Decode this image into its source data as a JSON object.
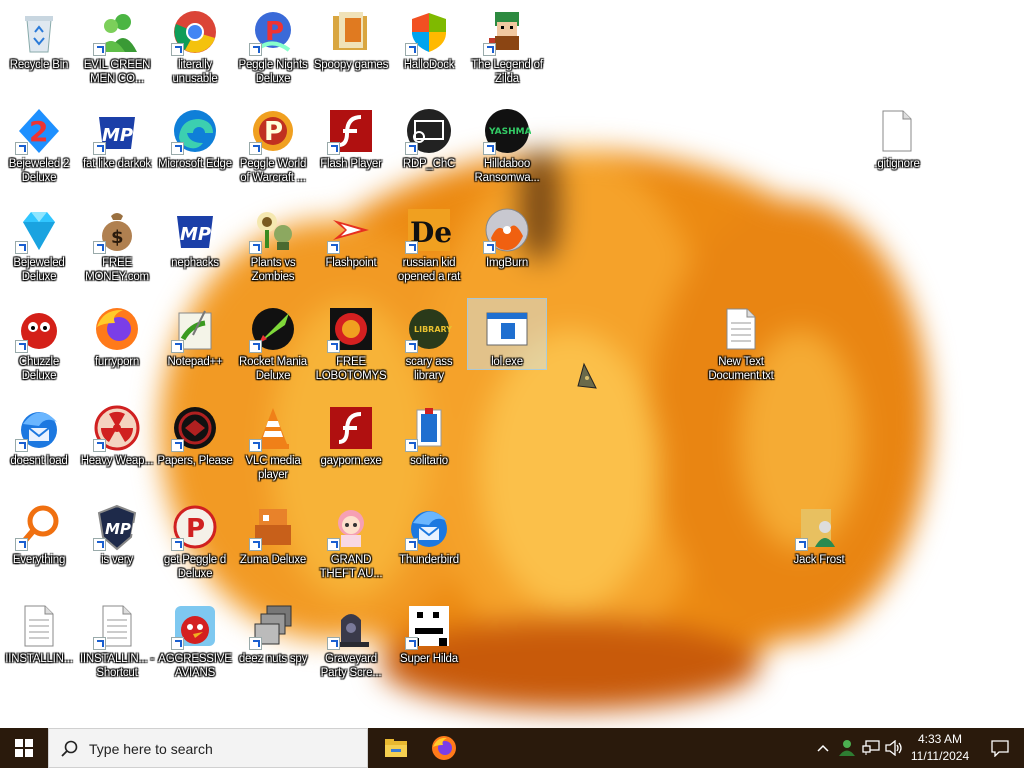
{
  "desktop": {
    "icons": [
      {
        "label": "Recycle Bin",
        "icon": "recycle-bin-icon",
        "shortcut": false
      },
      {
        "label": "EVIL GREEN MEN CO...",
        "icon": "msn-people-icon",
        "shortcut": true
      },
      {
        "label": "literally unusable",
        "icon": "chrome-icon",
        "shortcut": true
      },
      {
        "label": "Peggle Nights Deluxe",
        "icon": "peggle-nights-icon",
        "shortcut": true
      },
      {
        "label": "Spoopy games",
        "icon": "folder-icon",
        "shortcut": false
      },
      {
        "label": "HalloDock",
        "icon": "windows-shield-icon",
        "shortcut": true
      },
      {
        "label": "The Legend of Zilda",
        "icon": "zilda-character-icon",
        "shortcut": true
      },
      {
        "label": "Bejeweled 2 Deluxe",
        "icon": "bejeweled-2-icon",
        "shortcut": true
      },
      {
        "label": "fat like darkok",
        "icon": "mpi-icon",
        "shortcut": true
      },
      {
        "label": "Microsoft Edge",
        "icon": "edge-icon",
        "shortcut": true
      },
      {
        "label": "Peggle World of Warcraft ...",
        "icon": "peggle-wow-icon",
        "shortcut": true
      },
      {
        "label": "Flash Player",
        "icon": "flash-player-icon",
        "shortcut": true
      },
      {
        "label": "RDP_ChC",
        "icon": "rdp-icon",
        "shortcut": true
      },
      {
        "label": "Hilldaboo Ransomwa...",
        "icon": "yashma-icon",
        "shortcut": true
      },
      {
        "label": "Bejeweled Deluxe",
        "icon": "diamond-icon",
        "shortcut": true
      },
      {
        "label": "FREE MONEY.com",
        "icon": "money-bag-icon",
        "shortcut": true
      },
      {
        "label": "nephacks",
        "icon": "mpi-icon",
        "shortcut": false
      },
      {
        "label": "Plants vs Zombies",
        "icon": "plants-vs-zombies-icon",
        "shortcut": true
      },
      {
        "label": "Flashpoint",
        "icon": "flashpoint-icon",
        "shortcut": true
      },
      {
        "label": "russian kid opened a rat",
        "icon": "de-icon",
        "shortcut": true
      },
      {
        "label": "ImgBurn",
        "icon": "imgburn-disc-icon",
        "shortcut": true
      },
      {
        "label": "Chuzzle Deluxe",
        "icon": "chuzzle-icon",
        "shortcut": true
      },
      {
        "label": "furryporn",
        "icon": "firefox-icon",
        "shortcut": false
      },
      {
        "label": "Notepad++",
        "icon": "notepad-plus-plus-icon",
        "shortcut": true
      },
      {
        "label": "Rocket Mania Deluxe",
        "icon": "rocket-mania-icon",
        "shortcut": true
      },
      {
        "label": "FREE LOBOTOMYS",
        "icon": "lobotomy-icon",
        "shortcut": true
      },
      {
        "label": "scary ass library",
        "icon": "library-icon",
        "shortcut": true
      },
      {
        "label": "lol.exe",
        "icon": "exe-window-icon",
        "shortcut": false
      },
      {
        "label": "New Text Document.txt",
        "icon": "text-file-icon",
        "shortcut": false
      },
      {
        "label": ".gitignore",
        "icon": "blank-file-icon",
        "shortcut": false
      },
      {
        "label": "doesnt load",
        "icon": "thunderbird-icon",
        "shortcut": true
      },
      {
        "label": "Heavy Weap...",
        "icon": "radiation-icon",
        "shortcut": true
      },
      {
        "label": "Papers, Please",
        "icon": "papers-please-icon",
        "shortcut": true
      },
      {
        "label": "VLC media player",
        "icon": "vlc-icon",
        "shortcut": true
      },
      {
        "label": "gayporn.exe",
        "icon": "flash-player-icon",
        "shortcut": false
      },
      {
        "label": "solitario",
        "icon": "solitaire-icon",
        "shortcut": true
      },
      {
        "label": "Everything",
        "icon": "everything-search-icon",
        "shortcut": true
      },
      {
        "label": "is very",
        "icon": "mpi-shield-icon",
        "shortcut": true
      },
      {
        "label": "get Peggle d Deluxe",
        "icon": "peggle-icon",
        "shortcut": true
      },
      {
        "label": "Zuma Deluxe",
        "icon": "zuma-icon",
        "shortcut": true
      },
      {
        "label": "GRAND THEFT AU...",
        "icon": "anime-girl-icon",
        "shortcut": true
      },
      {
        "label": "Thunderbird",
        "icon": "thunderbird-icon",
        "shortcut": true
      },
      {
        "label": "Jack Frost",
        "icon": "user-folder-icon",
        "shortcut": true
      },
      {
        "label": "IINSTALLIN...",
        "icon": "text-file-icon",
        "shortcut": false
      },
      {
        "label": "IINSTALLIN... - Shortcut",
        "icon": "text-file-icon",
        "shortcut": true
      },
      {
        "label": "AGGRESSIVE AVIANS",
        "icon": "angry-bird-icon",
        "shortcut": true
      },
      {
        "label": "deez nuts spy",
        "icon": "stacked-windows-icon",
        "shortcut": true
      },
      {
        "label": "Graveyard Party Scre...",
        "icon": "graveyard-icon",
        "shortcut": true
      },
      {
        "label": "Super Hilda",
        "icon": "pixel-character-icon",
        "shortcut": true
      }
    ]
  },
  "taskbar": {
    "search_placeholder": "Type here to search",
    "pinned": [
      {
        "name": "file-explorer",
        "icon": "folder-icon"
      },
      {
        "name": "firefox",
        "icon": "firefox-icon"
      }
    ],
    "tray": {
      "icons": [
        "chevron-up-icon",
        "person-tray-icon",
        "network-icon",
        "volume-icon"
      ],
      "time": "4:33 AM",
      "date": "11/11/2024"
    },
    "notification_icon": "notification-icon"
  },
  "colors": {
    "taskbar": "#2a1a0c",
    "pumpkin": "#f08a10",
    "search_bg": "#f3f3f3"
  }
}
